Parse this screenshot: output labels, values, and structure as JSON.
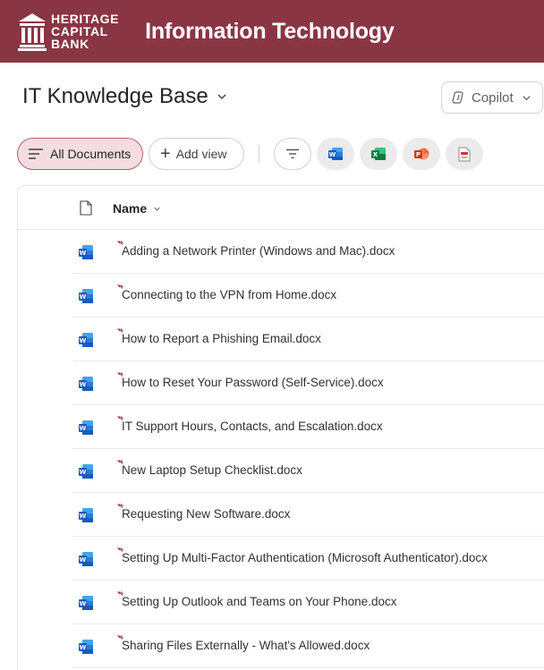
{
  "header": {
    "brand_lines": [
      "HERITAGE",
      "CAPITAL",
      "BANK"
    ],
    "site_title": "Information Technology",
    "bg_color": "#8a3544"
  },
  "library": {
    "title": "IT Knowledge Base",
    "copilot_label": "Copilot"
  },
  "toolbar": {
    "current_view": "All Documents",
    "add_view_label": "Add view",
    "app_icons": [
      "word-icon",
      "excel-icon",
      "powerpoint-icon",
      "pdf-icon"
    ]
  },
  "list": {
    "column_name": "Name",
    "files": [
      "Adding a Network Printer (Windows and Mac).docx",
      "Connecting to the VPN from Home.docx",
      "How to Report a Phishing Email.docx",
      "How to Reset Your Password (Self-Service).docx",
      "IT Support Hours, Contacts, and Escalation.docx",
      "New Laptop Setup Checklist.docx",
      "Requesting New Software.docx",
      "Setting Up Multi-Factor Authentication (Microsoft Authenticator).docx",
      "Setting Up Outlook and Teams on Your Phone.docx",
      "Sharing Files Externally - What's Allowed.docx"
    ]
  }
}
